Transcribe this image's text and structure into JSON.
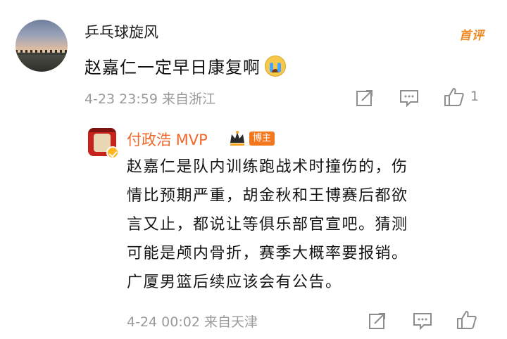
{
  "comment": {
    "username": "乒乓球旋风",
    "text": "赵嘉仁一定早日康复啊",
    "emoji": "crying-face-emoji",
    "badge": "首评",
    "meta": "4-23 23:59  来自浙江",
    "like_count": "1"
  },
  "reply": {
    "username": "付政浩 MVP",
    "role_tag": "博主",
    "lines": [
      "赵嘉仁是队内训练跑战术时撞伤的，伤",
      "情比预期严重，胡金秋和王博赛后都欲",
      "言又止，都说让等俱乐部官宣吧。猜测",
      "可能是颅内骨折，赛季大概率要报销。",
      "广厦男篮后续应该会有公告。"
    ],
    "meta": "4-24 00:02  来自天津"
  },
  "colors": {
    "accent_orange": "#f0672a",
    "badge_orange": "#f08a24",
    "meta_gray": "#9a9a9a"
  }
}
